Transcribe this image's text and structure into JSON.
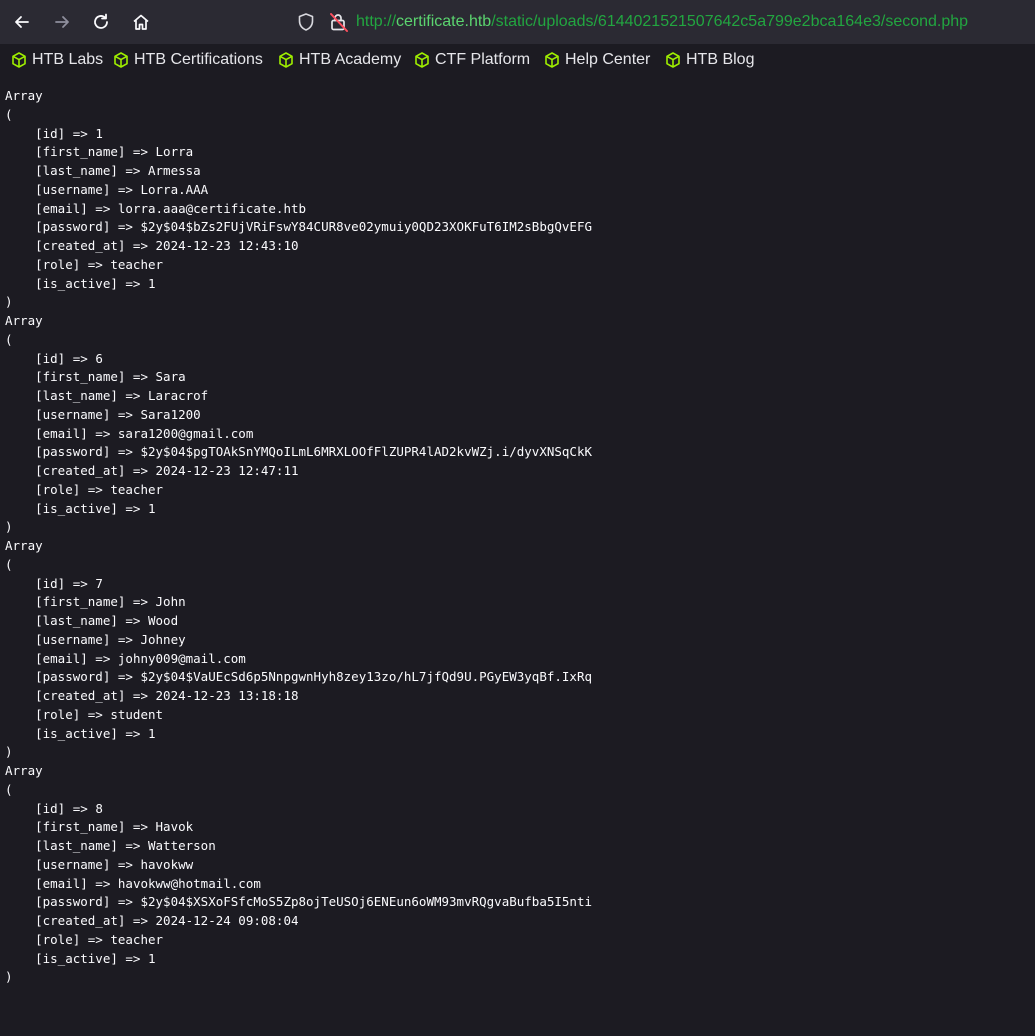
{
  "browser": {
    "back_icon": "arrow-left-icon",
    "forward_icon": "arrow-right-icon",
    "reload_icon": "reload-icon",
    "home_icon": "home-icon",
    "shield_icon": "shield-icon",
    "lock_icon": "insecure-lock-icon",
    "url_protocol": "http://",
    "url_domain": "certificate.htb",
    "url_path": "/static/uploads/6144021521507642c5a799e2bca164e3/second.php",
    "accent_color": "#2bb24c"
  },
  "bookmarks": [
    {
      "label": "HTB Labs",
      "icon": "htb-cube-icon"
    },
    {
      "label": "HTB Certifications",
      "icon": "htb-cube-icon"
    },
    {
      "label": "HTB Academy",
      "icon": "htb-cube-icon"
    },
    {
      "label": "CTF Platform",
      "icon": "htb-cube-icon"
    },
    {
      "label": "Help Center",
      "icon": "htb-cube-icon"
    },
    {
      "label": "HTB Blog",
      "icon": "htb-cube-icon"
    }
  ],
  "records": [
    {
      "id": "1",
      "first_name": "Lorra",
      "last_name": "Armessa",
      "username": "Lorra.AAA",
      "email": "lorra.aaa@certificate.htb",
      "password": "$2y$04$bZs2FUjVRiFswY84CUR8ve02ymuiy0QD23XOKFuT6IM2sBbgQvEFG",
      "created_at": "2024-12-23 12:43:10",
      "role": "teacher",
      "is_active": "1"
    },
    {
      "id": "6",
      "first_name": "Sara",
      "last_name": "Laracrof",
      "username": "Sara1200",
      "email": "sara1200@gmail.com",
      "password": "$2y$04$pgTOAkSnYMQoILmL6MRXLOOfFlZUPR4lAD2kvWZj.i/dyvXNSqCkK",
      "created_at": "2024-12-23 12:47:11",
      "role": "teacher",
      "is_active": "1"
    },
    {
      "id": "7",
      "first_name": "John",
      "last_name": "Wood",
      "username": "Johney",
      "email": "johny009@mail.com",
      "password": "$2y$04$VaUEcSd6p5NnpgwnHyh8zey13zo/hL7jfQd9U.PGyEW3yqBf.IxRq",
      "created_at": "2024-12-23 13:18:18",
      "role": "student",
      "is_active": "1"
    },
    {
      "id": "8",
      "first_name": "Havok",
      "last_name": "Watterson",
      "username": "havokww",
      "email": "havokww@hotmail.com",
      "password": "$2y$04$XSXoFSfcMoS5Zp8ojTeUSOj6ENEun6oWM93mvRQgvaBufba5I5nti",
      "created_at": "2024-12-24 09:08:04",
      "role": "teacher",
      "is_active": "1"
    }
  ]
}
